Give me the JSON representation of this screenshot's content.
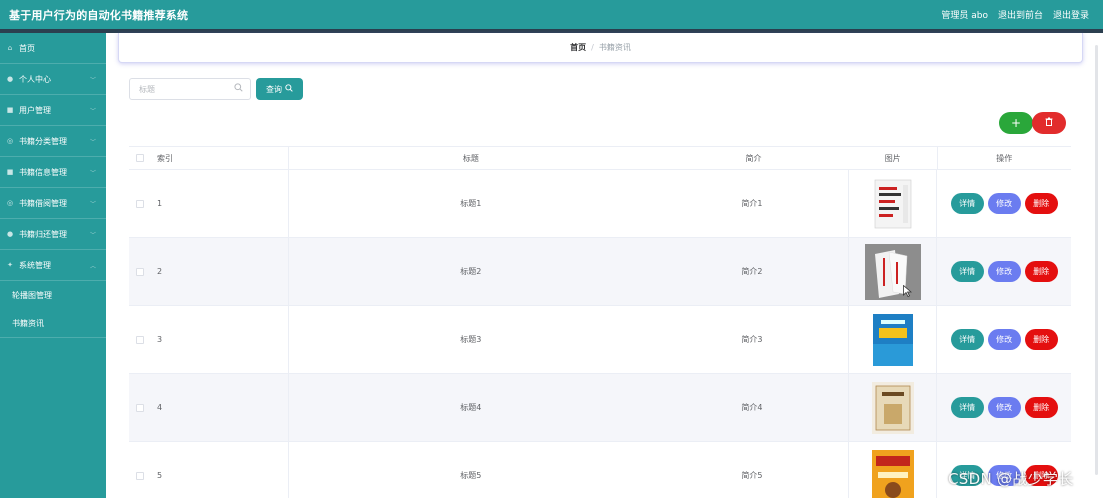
{
  "header": {
    "app_title": "基于用户行为的自动化书籍推荐系统",
    "admin_label": "管理员 abo",
    "to_frontend": "退出到前台",
    "logout": "退出登录"
  },
  "sidebar": {
    "items": [
      {
        "label": "首页",
        "icon": "home-icon"
      },
      {
        "label": "个人中心",
        "icon": "person-icon"
      },
      {
        "label": "用户管理",
        "icon": "users-icon"
      },
      {
        "label": "书籍分类管理",
        "icon": "category-icon"
      },
      {
        "label": "书籍信息管理",
        "icon": "book-icon"
      },
      {
        "label": "书籍借阅管理",
        "icon": "borrow-icon"
      },
      {
        "label": "书籍归还管理",
        "icon": "return-icon"
      },
      {
        "label": "系统管理",
        "icon": "gear-icon"
      }
    ],
    "sub_items": [
      {
        "label": "轮播图管理"
      },
      {
        "label": "书籍资讯"
      }
    ]
  },
  "breadcrumb": {
    "home": "首页",
    "separator": "/",
    "current": "书籍资讯"
  },
  "search": {
    "placeholder": "标题",
    "button_label": "查询"
  },
  "toolbar": {
    "add_symbol": "+",
    "delete_symbol": "🗑"
  },
  "table": {
    "columns": [
      "索引",
      "标题",
      "简介",
      "图片",
      "操作"
    ],
    "rows": [
      {
        "index": "1",
        "title": "标题1",
        "intro": "简介1"
      },
      {
        "index": "2",
        "title": "标题2",
        "intro": "简介2"
      },
      {
        "index": "3",
        "title": "标题3",
        "intro": "简介3"
      },
      {
        "index": "4",
        "title": "标题4",
        "intro": "简介4"
      },
      {
        "index": "5",
        "title": "标题5",
        "intro": "简介5"
      }
    ],
    "actions": {
      "detail": "详情",
      "edit": "修改",
      "delete": "删除"
    }
  },
  "watermark": "CSDN @战少学长",
  "colors": {
    "primary": "#279b9b",
    "edit": "#6b7cf0",
    "danger": "#e40f0f",
    "add": "#2aa73a"
  }
}
